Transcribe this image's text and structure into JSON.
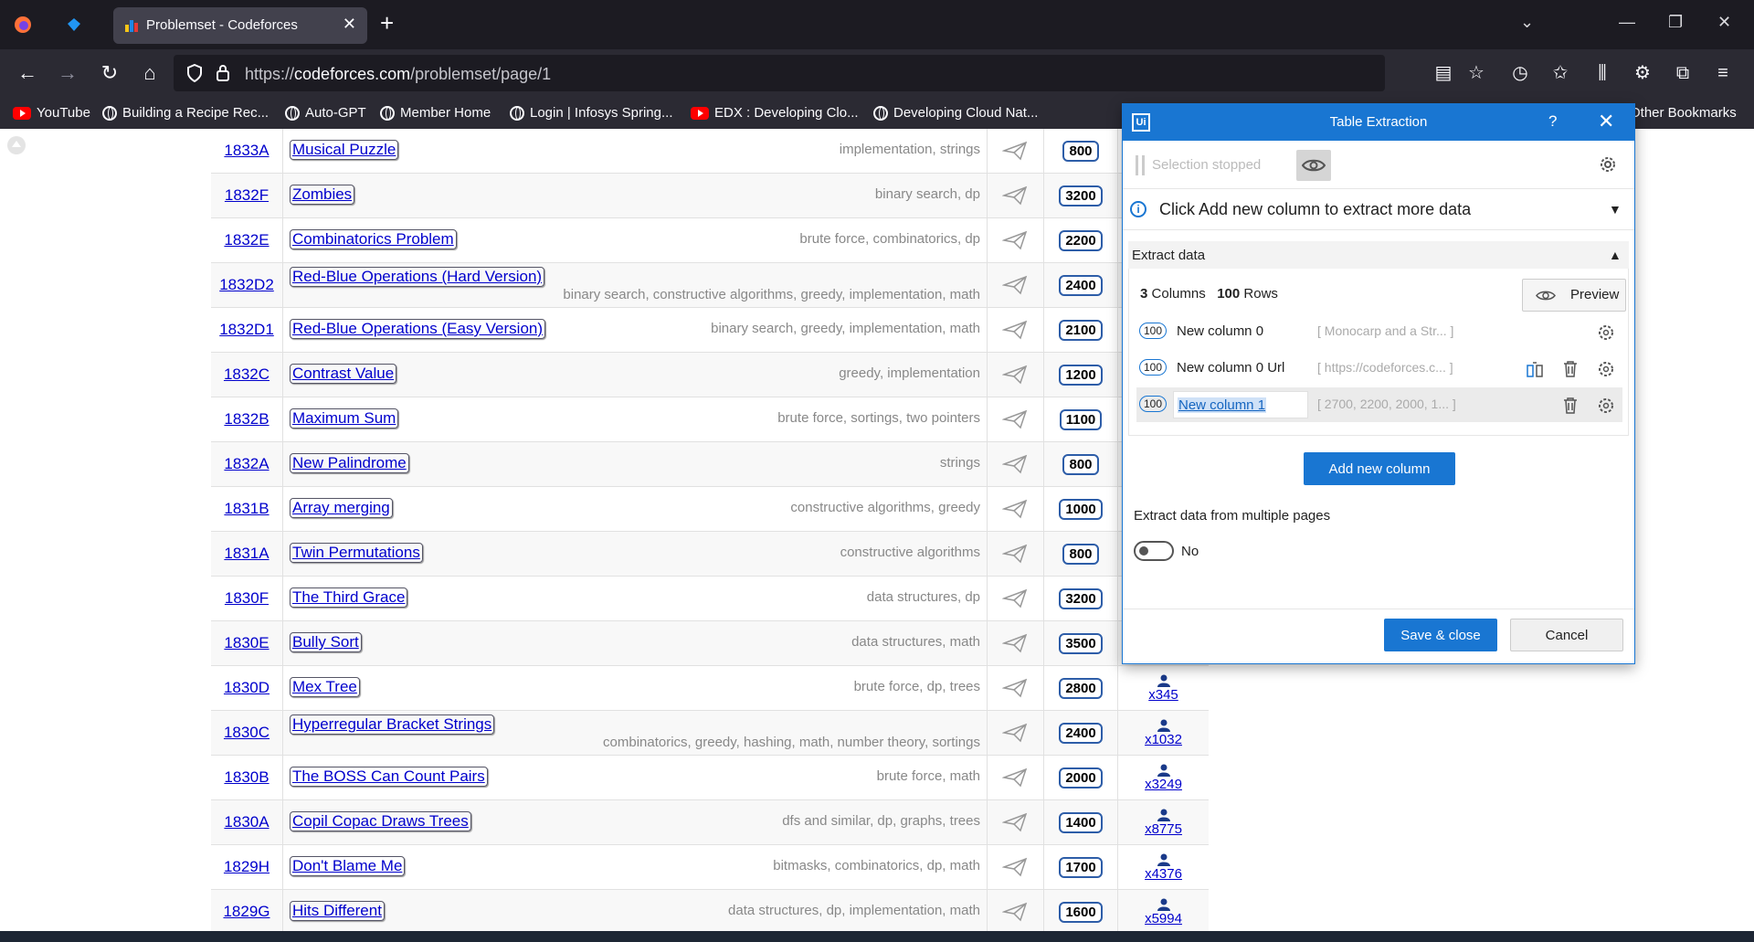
{
  "browser": {
    "tab_title": "Problemset - Codeforces",
    "url_prefix": "https://",
    "url_host": "codeforces.com",
    "url_path": "/problemset/page/1",
    "bookmarks": [
      {
        "label": "YouTube",
        "icon": "youtube-icon"
      },
      {
        "label": "Building a Recipe Rec...",
        "icon": "globe-icon"
      },
      {
        "label": "Auto-GPT",
        "icon": "github-icon"
      },
      {
        "label": "Member Home",
        "icon": "globe-icon"
      },
      {
        "label": "Login | Infosys Spring...",
        "icon": "infosys-icon"
      },
      {
        "label": "EDX : Developing Clo...",
        "icon": "youtube-icon"
      },
      {
        "label": "Developing Cloud Nat...",
        "icon": "globe-icon"
      }
    ],
    "other_bookmarks": "Other Bookmarks"
  },
  "problems": [
    {
      "id": "1833A",
      "name": "Musical Puzzle",
      "tags": "implementation, strings",
      "rating": "800",
      "solved": ""
    },
    {
      "id": "1832F",
      "name": "Zombies",
      "tags": "binary search, dp",
      "rating": "3200",
      "solved": ""
    },
    {
      "id": "1832E",
      "name": "Combinatorics Problem",
      "tags": "brute force, combinatorics, dp",
      "rating": "2200",
      "solved": ""
    },
    {
      "id": "1832D2",
      "name": "Red-Blue Operations (Hard Version)",
      "tags": "binary search, constructive algorithms, greedy, implementation, math",
      "rating": "2400",
      "solved": ""
    },
    {
      "id": "1832D1",
      "name": "Red-Blue Operations (Easy Version)",
      "tags": "binary search, greedy, implementation, math",
      "rating": "2100",
      "solved": ""
    },
    {
      "id": "1832C",
      "name": "Contrast Value",
      "tags": "greedy, implementation",
      "rating": "1200",
      "solved": ""
    },
    {
      "id": "1832B",
      "name": "Maximum Sum",
      "tags": "brute force, sortings, two pointers",
      "rating": "1100",
      "solved": ""
    },
    {
      "id": "1832A",
      "name": "New Palindrome",
      "tags": "strings",
      "rating": "800",
      "solved": ""
    },
    {
      "id": "1831B",
      "name": "Array merging",
      "tags": "constructive algorithms, greedy",
      "rating": "1000",
      "solved": ""
    },
    {
      "id": "1831A",
      "name": "Twin Permutations",
      "tags": "constructive algorithms",
      "rating": "800",
      "solved": ""
    },
    {
      "id": "1830F",
      "name": "The Third Grace",
      "tags": "data structures, dp",
      "rating": "3200",
      "solved": ""
    },
    {
      "id": "1830E",
      "name": "Bully Sort",
      "tags": "data structures, math",
      "rating": "3500",
      "solved": ""
    },
    {
      "id": "1830D",
      "name": "Mex Tree",
      "tags": "brute force, dp, trees",
      "rating": "2800",
      "solved": "x345"
    },
    {
      "id": "1830C",
      "name": "Hyperregular Bracket Strings",
      "tags": "combinatorics, greedy, hashing, math, number theory, sortings",
      "rating": "2400",
      "solved": "x1032"
    },
    {
      "id": "1830B",
      "name": "The BOSS Can Count Pairs",
      "tags": "brute force, math",
      "rating": "2000",
      "solved": "x3249"
    },
    {
      "id": "1830A",
      "name": "Copil Copac Draws Trees",
      "tags": "dfs and similar, dp, graphs, trees",
      "rating": "1400",
      "solved": "x8775"
    },
    {
      "id": "1829H",
      "name": "Don't Blame Me",
      "tags": "bitmasks, combinatorics, dp, math",
      "rating": "1700",
      "solved": "x4376"
    },
    {
      "id": "1829G",
      "name": "Hits Different",
      "tags": "data structures, dp, implementation, math",
      "rating": "1600",
      "solved": "x5994"
    },
    {
      "id": "",
      "name": "",
      "tags": "",
      "rating": "",
      "solved": ""
    }
  ],
  "dialog": {
    "title": "Table Extraction",
    "help": "?",
    "selection_status": "Selection stopped",
    "info_text": "Click Add new column to extract more data",
    "extract_header": "Extract data",
    "columns_count": "3",
    "columns_word": "Columns",
    "rows_count": "100",
    "rows_word": "Rows",
    "preview_label": "Preview",
    "columns": [
      {
        "count": "100",
        "name": "New column 0",
        "sample": "[ Monocarp and a Str... ]"
      },
      {
        "count": "100",
        "name": "New column 0 Url",
        "sample": "[ https://codeforces.c... ]"
      },
      {
        "count": "100",
        "name": "New column 1",
        "sample": "[ 2700, 2200, 2000, 1... ]"
      }
    ],
    "add_column_label": "Add new column",
    "multi_page_label": "Extract data from multiple pages",
    "multi_page_value": "No",
    "save_label": "Save & close",
    "cancel_label": "Cancel"
  }
}
